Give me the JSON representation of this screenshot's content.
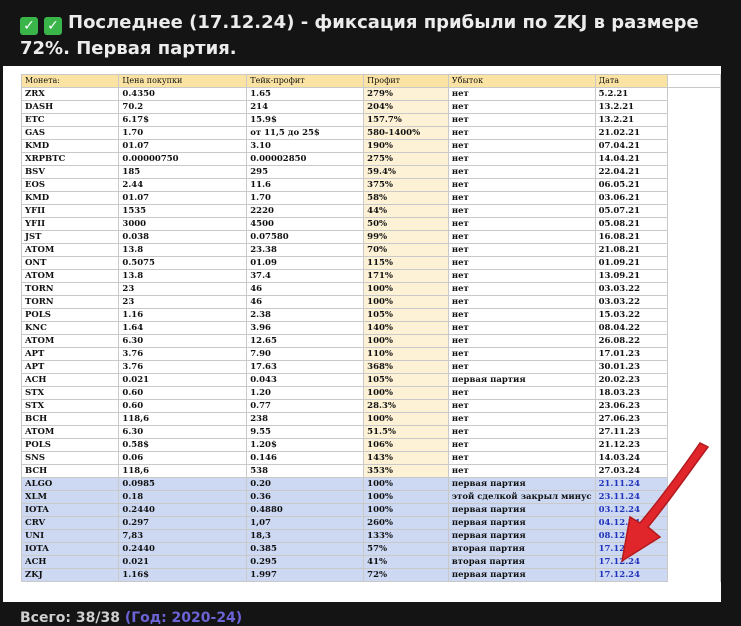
{
  "headline": {
    "icons": [
      "check-mark-icon",
      "check-mark-icon"
    ],
    "text": "Последнее (17.12.24) - фиксация прибыли по ZKJ в размере 72%. Первая партия."
  },
  "table": {
    "headers": [
      "Монета:",
      "Цена покупки",
      "Тейк-профит",
      "Профит",
      "Убыток",
      "Дата"
    ],
    "rows": [
      [
        "ZRX",
        "0.4350",
        "1.65",
        "279%",
        "нет",
        "5.2.21"
      ],
      [
        "DASH",
        "70.2",
        "214",
        "204%",
        "нет",
        "13.2.21"
      ],
      [
        "ETC",
        "6.17$",
        "15.9$",
        "157.7%",
        "нет",
        "13.2.21"
      ],
      [
        "GAS",
        "1.70",
        "от 11,5 до 25$",
        "580-1400%",
        "нет",
        "21.02.21"
      ],
      [
        "KMD",
        "01.07",
        "3.10",
        "190%",
        "нет",
        "07.04.21"
      ],
      [
        "XRPBTC",
        "0.00000750",
        "0.00002850",
        "275%",
        "нет",
        "14.04.21"
      ],
      [
        "BSV",
        "185",
        "295",
        "59.4%",
        "нет",
        "22.04.21"
      ],
      [
        "EOS",
        "2.44",
        "11.6",
        "375%",
        "нет",
        "06.05.21"
      ],
      [
        "KMD",
        "01.07",
        "1.70",
        "58%",
        "нет",
        "03.06.21"
      ],
      [
        "YFII",
        "1535",
        "2220",
        "44%",
        "нет",
        "05.07.21"
      ],
      [
        "YFII",
        "3000",
        "4500",
        "50%",
        "нет",
        "05.08.21"
      ],
      [
        "JST",
        "0.038",
        "0.07580",
        "99%",
        "нет",
        "16.08.21"
      ],
      [
        "ATOM",
        "13.8",
        "23.38",
        "70%",
        "нет",
        "21.08.21"
      ],
      [
        "ONT",
        "0.5075",
        "01.09",
        "115%",
        "нет",
        "01.09.21"
      ],
      [
        "ATOM",
        "13.8",
        "37.4",
        "171%",
        "нет",
        "13.09.21"
      ],
      [
        "TORN",
        "23",
        "46",
        "100%",
        "нет",
        "03.03.22"
      ],
      [
        "TORN",
        "23",
        "46",
        "100%",
        "нет",
        "03.03.22"
      ],
      [
        "POLS",
        "1.16",
        "2.38",
        "105%",
        "нет",
        "15.03.22"
      ],
      [
        "KNC",
        "1.64",
        "3.96",
        "140%",
        "нет",
        "08.04.22"
      ],
      [
        "ATOM",
        "6.30",
        "12.65",
        "100%",
        "нет",
        "26.08.22"
      ],
      [
        "APT",
        "3.76",
        "7.90",
        "110%",
        "нет",
        "17.01.23"
      ],
      [
        "APT",
        "3.76",
        "17.63",
        "368%",
        "нет",
        "30.01.23"
      ],
      [
        "ACH",
        "0.021",
        "0.043",
        "105%",
        "первая партия",
        "20.02.23"
      ],
      [
        "STX",
        "0.60",
        "1.20",
        "100%",
        "нет",
        "18.03.23"
      ],
      [
        "STX",
        "0.60",
        "0.77",
        "28.3%",
        "нет",
        "23.06.23"
      ],
      [
        "BCH",
        "118,6",
        "238",
        "100%",
        "нет",
        "27.06.23"
      ],
      [
        "ATOM",
        "6.30",
        "9.55",
        "51.5%",
        "нет",
        "27.11.23"
      ],
      [
        "POLS",
        "0.58$",
        "1.20$",
        "106%",
        "нет",
        "21.12.23"
      ],
      [
        "SNS",
        "0.06",
        "0.146",
        "143%",
        "нет",
        "14.03.24"
      ],
      [
        "BCH",
        "118,6",
        "538",
        "353%",
        "нет",
        "27.03.24"
      ]
    ],
    "highlighted_rows": [
      [
        "ALGO",
        "0.0985",
        "0.20",
        "100%",
        "первая партия",
        "21.11.24"
      ],
      [
        "XLM",
        "0.18",
        "0.36",
        "100%",
        "этой сделкой закрыл минус",
        "23.11.24"
      ],
      [
        "IOTA",
        "0.2440",
        "0.4880",
        "100%",
        "первая партия",
        "03.12.24"
      ],
      [
        "CRV",
        "0.297",
        "1,07",
        "260%",
        "первая партия",
        "04.12.24"
      ],
      [
        "UNI",
        "7,83",
        "18,3",
        "133%",
        "первая партия",
        "08.12.24"
      ],
      [
        "IOTA",
        "0.2440",
        "0.385",
        "57%",
        "вторая партия",
        "17.12.24"
      ],
      [
        "ACH",
        "0.021",
        "0.295",
        "41%",
        "вторая партия",
        "17.12.24"
      ],
      [
        "ZKJ",
        "1.16$",
        "1.997",
        "72%",
        "первая партия",
        "17.12.24"
      ]
    ]
  },
  "colors": {
    "background": "#141414",
    "header_fill": "#fbe3a3",
    "profit_fill": "#fdf2d5",
    "highlight_fill": "#cdd9f3",
    "date_highlight_text": "#2233bb",
    "arrow": "#e0262b"
  },
  "arrow_icon": "red-arrow-icon",
  "footer": {
    "text": "Всего: 38/38",
    "link": "(Год: 2020-24)"
  }
}
